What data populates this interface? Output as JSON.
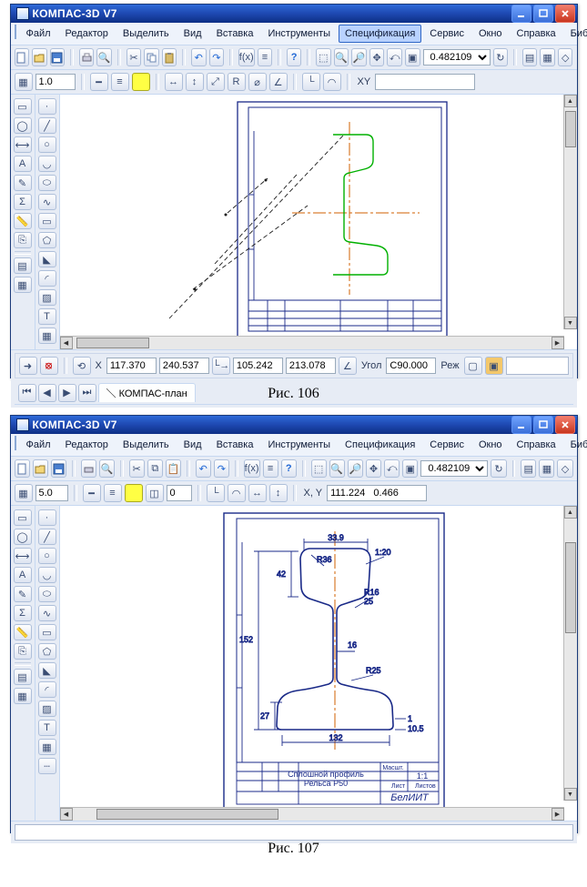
{
  "fig106": {
    "title": "КОМПАС-3D V7",
    "caption": "Рис. 106",
    "menu": [
      "Файл",
      "Редактор",
      "Выделить",
      "Вид",
      "Вставка",
      "Инструменты",
      "Спецификация",
      "Сервис",
      "Окно",
      "Справка",
      "Библиотеки"
    ],
    "menu_hot_index": 6,
    "tb1_dropdown": "",
    "tb2_zoom_combo": "0.482109",
    "tb2_zoom_field": "",
    "tb3_left": "1.0",
    "coords": {
      "x_label": "X",
      "x": "117.370",
      "y": "240.537",
      "dx": "105.242",
      "dy": "213.078",
      "ang_label": "Угол",
      "ang": "C90.000",
      "mode": "Реж"
    },
    "tab_label": "КОМПАС-план"
  },
  "fig107": {
    "title": "КОМПАС-3D V7",
    "caption": "Рис. 107",
    "menu": [
      "Файл",
      "Редактор",
      "Выделить",
      "Вид",
      "Вставка",
      "Инструменты",
      "Спецификация",
      "Сервис",
      "Окно",
      "Справка",
      "Библиотеки"
    ],
    "tb2_zoom_combo": "0.482109",
    "tb3_scale": "5.0",
    "tb3_offset": "0",
    "tb3_coords_label": "X, Y",
    "tb3_coords": "111.224   0.466",
    "dims": {
      "top_width": "33.9",
      "radius_top": "R36",
      "side_taper": "1:20",
      "head_h": "42",
      "full_h": "152",
      "web": "16",
      "fillet": "R16",
      "r25": "25",
      "r25b": "R25",
      "base_h": "27",
      "base_w": "132",
      "base_edge": "1",
      "base_edge_h": "10.5"
    },
    "titleblock": {
      "name": "Сплошной профиль",
      "desig": "Рельса Р50",
      "org": "БелИИТ",
      "scale_label": "Масшт.",
      "scale": "1:1",
      "sheet_label": "Лист",
      "sheets_label": "Листов"
    }
  },
  "icons": {
    "new": "new-icon",
    "open": "open-icon",
    "save": "save-icon",
    "print": "print-icon",
    "cut": "cut-icon",
    "copy": "copy-icon",
    "paste": "paste-icon",
    "undo": "undo-icon",
    "redo": "redo-icon",
    "zoom_in": "zoom-in-icon",
    "zoom_out": "zoom-out-icon",
    "zoom_fit": "zoom-fit-icon",
    "help": "help-icon",
    "stop": "stop-icon",
    "arrow": "arrow-icon"
  }
}
